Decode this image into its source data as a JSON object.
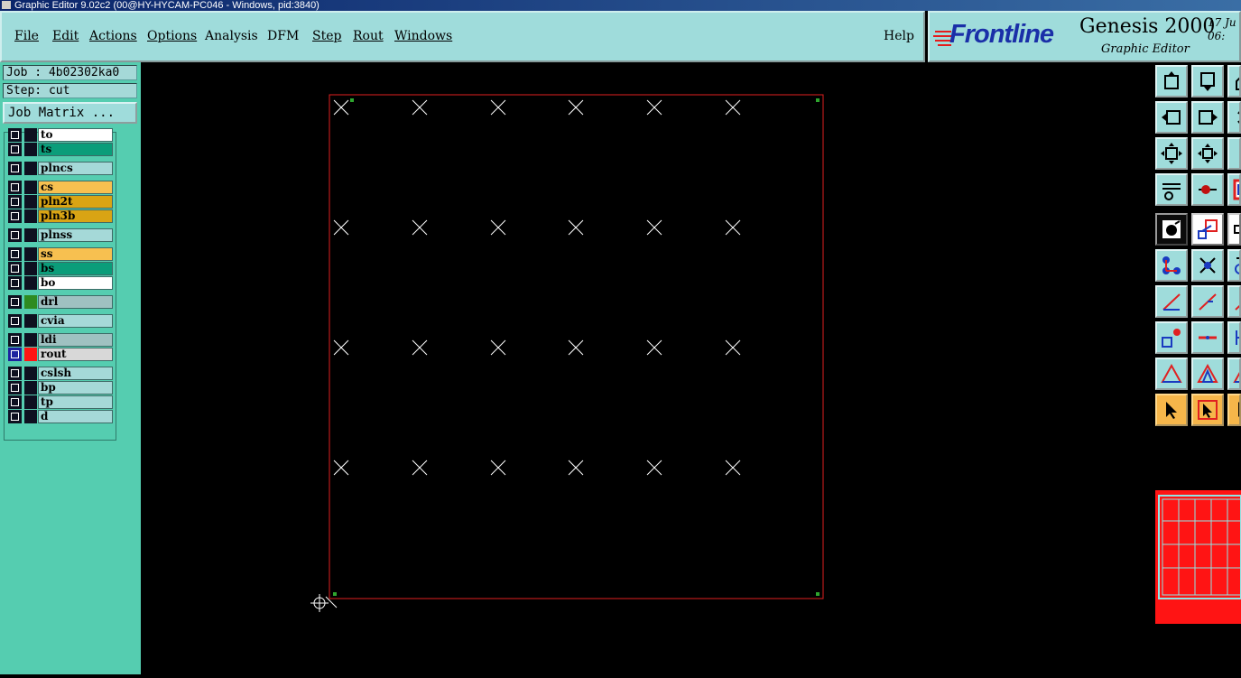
{
  "window": {
    "title": "Graphic Editor 9.02c2 (00@HY-HYCAM-PC046 - Windows, pid:3840)"
  },
  "menu": {
    "items": [
      {
        "label": "File"
      },
      {
        "label": "Edit"
      },
      {
        "label": "Actions"
      },
      {
        "label": "Options"
      },
      {
        "label": "Analysis"
      },
      {
        "label": "DFM"
      },
      {
        "label": "Step"
      },
      {
        "label": "Rout"
      },
      {
        "label": "Windows"
      }
    ],
    "help": "Help"
  },
  "brand": {
    "logo": "Frontline",
    "title": "Genesis 2000",
    "subtitle": "Graphic Editor",
    "date_line1": "17 Ju",
    "date_line2": "06:"
  },
  "job": {
    "job_label": "Job : 4b02302ka0",
    "step_label": "Step: cut",
    "matrix_button": "Job Matrix ..."
  },
  "layers": [
    {
      "name": "to",
      "color": "#ffffff"
    },
    {
      "name": "ts",
      "color": "#0b9d7a"
    },
    {
      "name": "plncs",
      "color": "#a5d9d8"
    },
    {
      "name": "cs",
      "color": "#f7c050"
    },
    {
      "name": "pln2t",
      "color": "#d9a414"
    },
    {
      "name": "pln3b",
      "color": "#d9a414"
    },
    {
      "name": "plnss",
      "color": "#a5d9d8"
    },
    {
      "name": "ss",
      "color": "#f7c050"
    },
    {
      "name": "bs",
      "color": "#0b9d7a"
    },
    {
      "name": "bo",
      "color": "#ffffff"
    },
    {
      "name": "drl",
      "color": "#9fc1c1",
      "swatch": "#2e8b21"
    },
    {
      "name": "cvia",
      "color": "#a5d9d8"
    },
    {
      "name": "ldi",
      "color": "#9fc1c1"
    },
    {
      "name": "rout",
      "color": "#d8d8d8",
      "swatch": "#ff1414",
      "selected": true
    },
    {
      "name": "cslsh",
      "color": "#a5d9d8"
    },
    {
      "name": "bp",
      "color": "#a5d9d8"
    },
    {
      "name": "tp",
      "color": "#a5d9d8"
    },
    {
      "name": "d",
      "color": "#a5d9d8"
    }
  ],
  "canvas": {
    "background": "#000000",
    "profile_color": "#e02020",
    "mark_color": "#ffffff",
    "marks": {
      "rows": 4,
      "columns": 6
    }
  },
  "toolbar": {
    "tools": [
      "move-up-icon",
      "move-down-icon",
      "home-icon",
      "move-left-icon",
      "move-right-icon",
      "undo-icon",
      "fit-screen-icon",
      "zoom-center-icon",
      "number-one-icon",
      "settings-icon",
      "snap-icon",
      "route-icon",
      "select-pad-icon",
      "measure-icon",
      "ruler-icon",
      "connect-icon",
      "cross-icon",
      "circle-icon",
      "line-angle-icon",
      "line-icon",
      "line-icon",
      "pad-add-icon",
      "line-horizontal-icon",
      "dimension-icon",
      "triangle-icon",
      "triangle-measure-icon",
      "triangle-icon",
      "pointer-icon",
      "pointer-box-icon",
      "pointer-icon"
    ]
  }
}
